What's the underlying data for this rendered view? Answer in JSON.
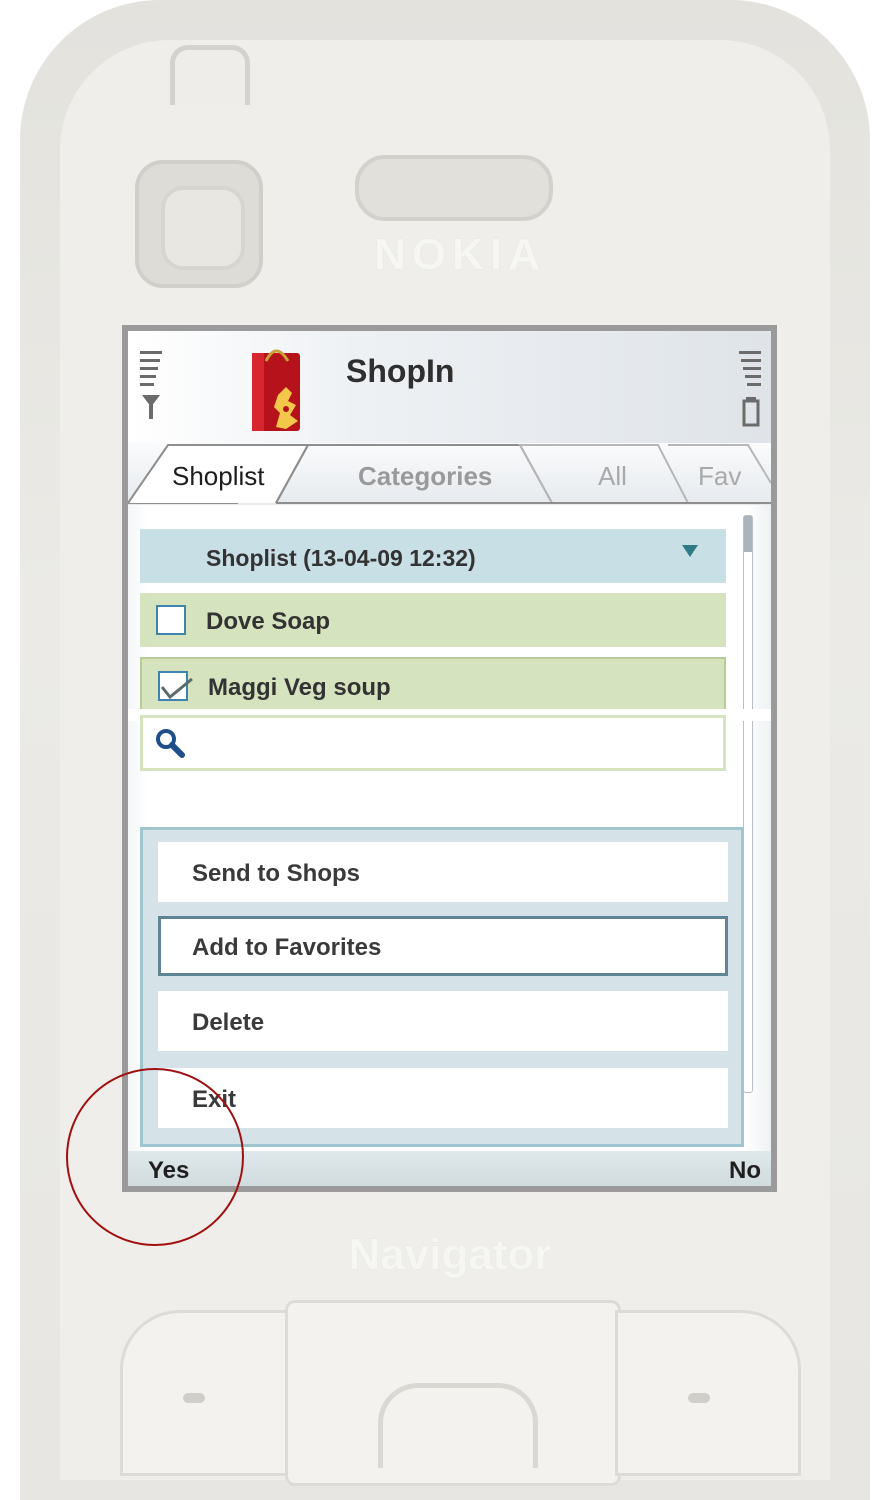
{
  "device": {
    "brand_logo": "NOKIA",
    "nav_logo": "Navigator"
  },
  "app": {
    "title": "ShopIn"
  },
  "tabs": [
    {
      "label": "Shoplist",
      "active": true
    },
    {
      "label": "Categories",
      "active": false
    },
    {
      "label": "All",
      "active": false
    },
    {
      "label": "Fav",
      "active": false
    }
  ],
  "list": {
    "header": "Shoplist (13-04-09 12:32)",
    "items": [
      {
        "label": "Dove Soap",
        "checked": false
      },
      {
        "label": "Maggi Veg soup",
        "checked": true
      }
    ]
  },
  "search": {
    "value": ""
  },
  "menu": {
    "items": [
      {
        "label": "Send to Shops"
      },
      {
        "label": "Add to Favorites",
        "focused": true
      },
      {
        "label": "Delete"
      },
      {
        "label": "Exit"
      }
    ]
  },
  "softkeys": {
    "left": "Yes",
    "right": "No"
  },
  "colors": {
    "list_header_bg": "#c9dfe6",
    "list_item_bg": "#d5e4bf",
    "checkbox_border": "#3f84ae",
    "annotation_circle": "#a01010"
  },
  "icons": [
    "signal-strength-icon",
    "battery-icon",
    "shopping-bag-icon",
    "dropdown-arrow-icon",
    "checkmark-icon",
    "search-icon"
  ]
}
